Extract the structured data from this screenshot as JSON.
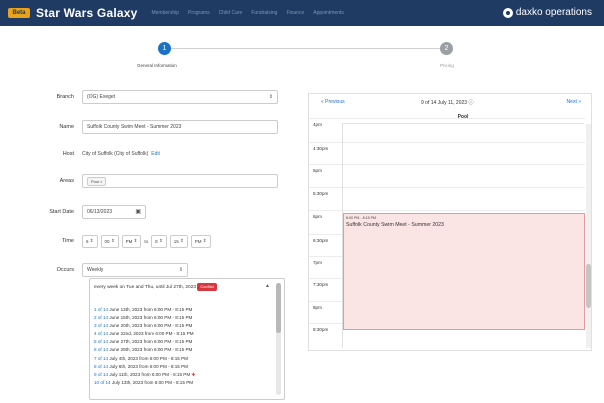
{
  "app": {
    "logo_badge": "Beta",
    "title": "Star Wars Galaxy",
    "nav": [
      "Membership",
      "Programs",
      "Child Care",
      "Fundraising",
      "Finance",
      "Appointments"
    ],
    "brand": "daxko operations"
  },
  "stepper": {
    "step1_number": "1",
    "step1_label": "General Information",
    "step2_number": "2",
    "step2_label": "Pricing"
  },
  "form": {
    "branch_label": "Branch",
    "branch_value": "(OG) Exeget",
    "name_label": "Name",
    "name_value": "Suffolk County Swim Meet - Summer 2023",
    "host_label": "Host",
    "host_value": "City of Suffolk (City of Suffolk)",
    "host_edit": "Edit",
    "areas_label": "Areas",
    "area_chip": "Pool ×",
    "start_date_label": "Start Date",
    "start_date_value": "06/13/2023",
    "time_label": "Time",
    "time": {
      "start_hour": "6",
      "start_min": "00",
      "start_ampm": "PM",
      "to": "to",
      "end_hour": "8",
      "end_min": "15",
      "end_ampm": "PM"
    },
    "occurs_label": "Occurs",
    "occurs_value": "Weekly"
  },
  "occurrences": {
    "description": "every week on Tue and Thu, until Jul 27th, 2023",
    "conflict_tag": "Conflict",
    "items": [
      {
        "idx": "1 of 14",
        "text": "June 13th, 2023 from 6:00 PM - 8:15 PM"
      },
      {
        "idx": "2 of 14",
        "text": "June 15th, 2023 from 6:00 PM - 8:15 PM"
      },
      {
        "idx": "3 of 14",
        "text": "June 20th, 2023 from 6:00 PM - 8:15 PM"
      },
      {
        "idx": "4 of 14",
        "text": "June 22nd, 2023 from 6:00 PM - 8:15 PM"
      },
      {
        "idx": "5 of 14",
        "text": "June 27th, 2023 from 6:00 PM - 8:15 PM"
      },
      {
        "idx": "6 of 14",
        "text": "June 29th, 2023 from 6:00 PM - 8:15 PM"
      },
      {
        "idx": "7 of 14",
        "text": "July 4th, 2023 from 6:00 PM - 8:15 PM"
      },
      {
        "idx": "8 of 14",
        "text": "July 6th, 2023 from 6:00 PM - 8:15 PM"
      },
      {
        "idx": "9 of 14",
        "text": "July 11th, 2023 from 6:00 PM - 8:15 PM"
      },
      {
        "idx": "10 of 14",
        "text": "July 13th, 2023 from 6:00 PM - 8:15 PM"
      }
    ],
    "conflict_marker": "✚"
  },
  "calendar": {
    "prev": "« Previous",
    "current": "9 of 14 July 11, 2023 ⓘ",
    "next": "Next »",
    "column": "Pool",
    "times": [
      "4pm",
      "4:30pm",
      "5pm",
      "5:30pm",
      "6pm",
      "6:30pm",
      "7pm",
      "7:30pm",
      "8pm",
      "8:30pm"
    ],
    "event_time": "6:00 PM - 8:15 PM",
    "event_title": "Suffolk County Swim Meet - Summer 2023"
  }
}
